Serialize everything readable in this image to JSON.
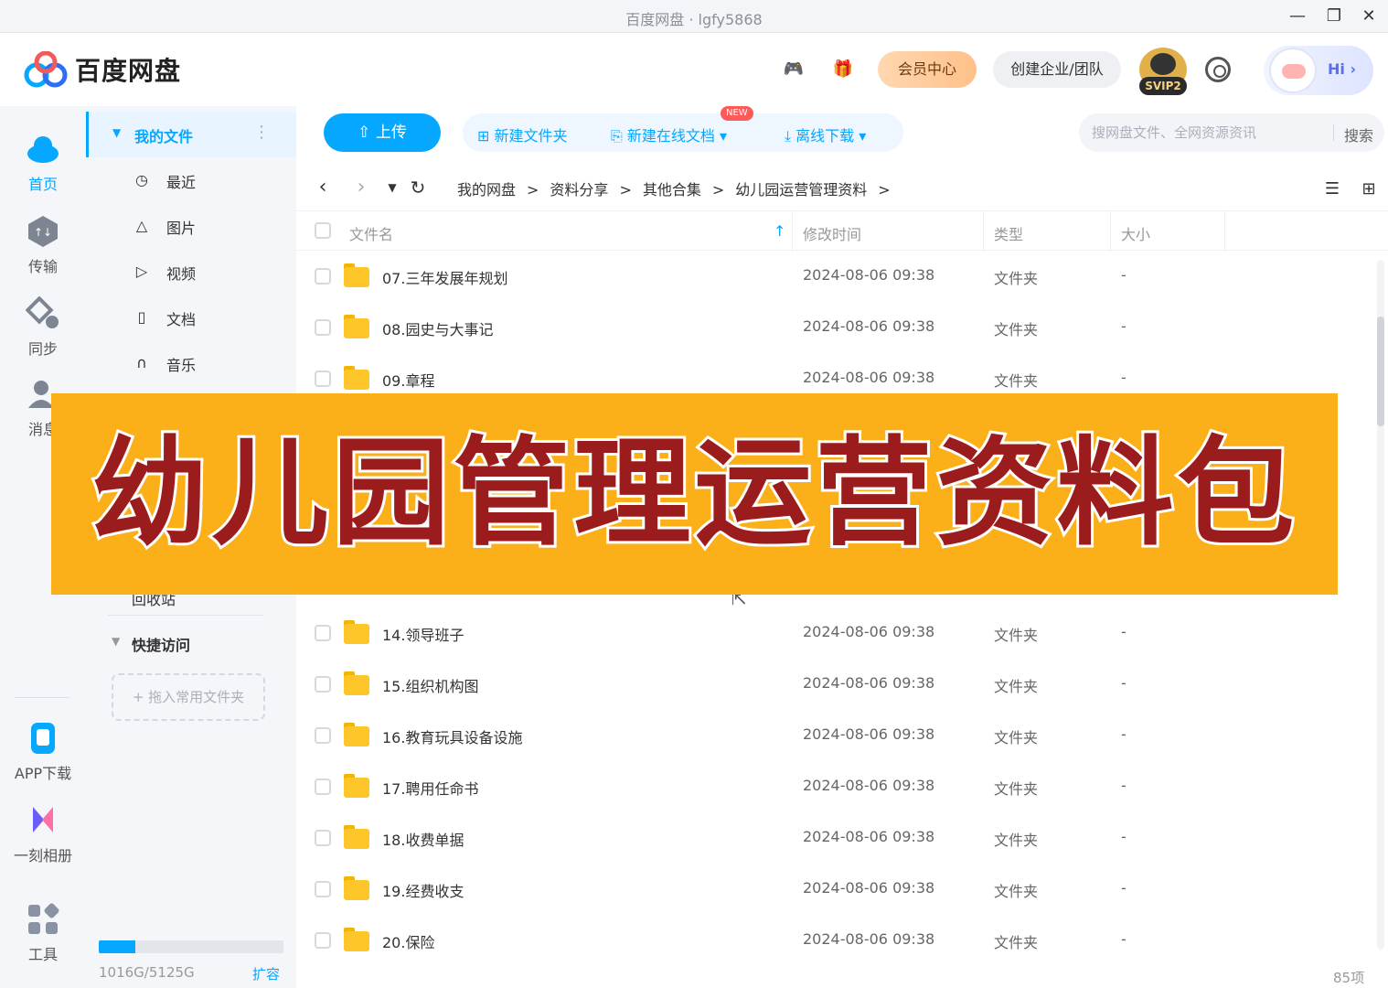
{
  "window": {
    "title": "百度网盘 · lgfy5868",
    "minimize": "—",
    "maximize": "❐",
    "close": "✕"
  },
  "header": {
    "logo_text": "百度网盘",
    "vip_label": "会员中心",
    "team_label": "创建企业/团队",
    "avatar_badge": "SVIP2",
    "assistant_label": "Hi ›",
    "accent": "#06a7ff"
  },
  "rail": {
    "items": [
      {
        "label": "首页",
        "icon": "cloud-icon"
      },
      {
        "label": "传输",
        "icon": "transfer-icon"
      },
      {
        "label": "同步",
        "icon": "sync-icon"
      },
      {
        "label": "消息",
        "icon": "message-icon"
      },
      {
        "label": "APP下载",
        "icon": "app-download-icon"
      },
      {
        "label": "一刻相册",
        "icon": "album-icon"
      },
      {
        "label": "工具",
        "icon": "tools-icon"
      }
    ]
  },
  "sidebar": {
    "my_files": "我的文件",
    "items": [
      {
        "label": "最近",
        "icon": "clock-icon"
      },
      {
        "label": "图片",
        "icon": "image-icon"
      },
      {
        "label": "视频",
        "icon": "video-icon"
      },
      {
        "label": "文档",
        "icon": "document-icon"
      },
      {
        "label": "音乐",
        "icon": "headphones-icon"
      }
    ],
    "recycle_partial": "回收站",
    "quick_access": "快捷访问",
    "quick_drop": "+ 拖入常用文件夹",
    "storage_text": "1016G/5125G",
    "storage_fraction": 0.198,
    "expand_label": "扩容"
  },
  "toolbar": {
    "upload": "上传",
    "new_folder": "新建文件夹",
    "new_online_doc": "新建在线文档",
    "new_badge": "NEW",
    "offline_download": "离线下载",
    "search_placeholder": "搜网盘文件、全网资源资讯",
    "search_button": "搜索"
  },
  "breadcrumb": [
    "我的网盘",
    "资料分享",
    "其他合集",
    "幼儿园运营管理资料"
  ],
  "table": {
    "headers": {
      "name": "文件名",
      "modified": "修改时间",
      "type": "类型",
      "size": "大小"
    },
    "rows": [
      {
        "name": "07.三年发展年规划",
        "time": "2024-08-06 09:38",
        "type": "文件夹",
        "size": "-"
      },
      {
        "name": "08.园史与大事记",
        "time": "2024-08-06 09:38",
        "type": "文件夹",
        "size": "-"
      },
      {
        "name": "09.章程",
        "time": "2024-08-06 09:38",
        "type": "文件夹",
        "size": "-"
      },
      {
        "name": "14.领导班子",
        "time": "2024-08-06 09:38",
        "type": "文件夹",
        "size": "-"
      },
      {
        "name": "15.组织机构图",
        "time": "2024-08-06 09:38",
        "type": "文件夹",
        "size": "-"
      },
      {
        "name": "16.教育玩具设备设施",
        "time": "2024-08-06 09:38",
        "type": "文件夹",
        "size": "-"
      },
      {
        "name": "17.聘用任命书",
        "time": "2024-08-06 09:38",
        "type": "文件夹",
        "size": "-"
      },
      {
        "name": "18.收费单据",
        "time": "2024-08-06 09:38",
        "type": "文件夹",
        "size": "-"
      },
      {
        "name": "19.经费收支",
        "time": "2024-08-06 09:38",
        "type": "文件夹",
        "size": "-"
      },
      {
        "name": "20.保险",
        "time": "2024-08-06 09:38",
        "type": "文件夹",
        "size": "-"
      }
    ],
    "count": "85项"
  },
  "banner": {
    "text": "幼儿园管理运营资料包",
    "bg": "#fbb01a",
    "fg": "#9b1c1c"
  }
}
